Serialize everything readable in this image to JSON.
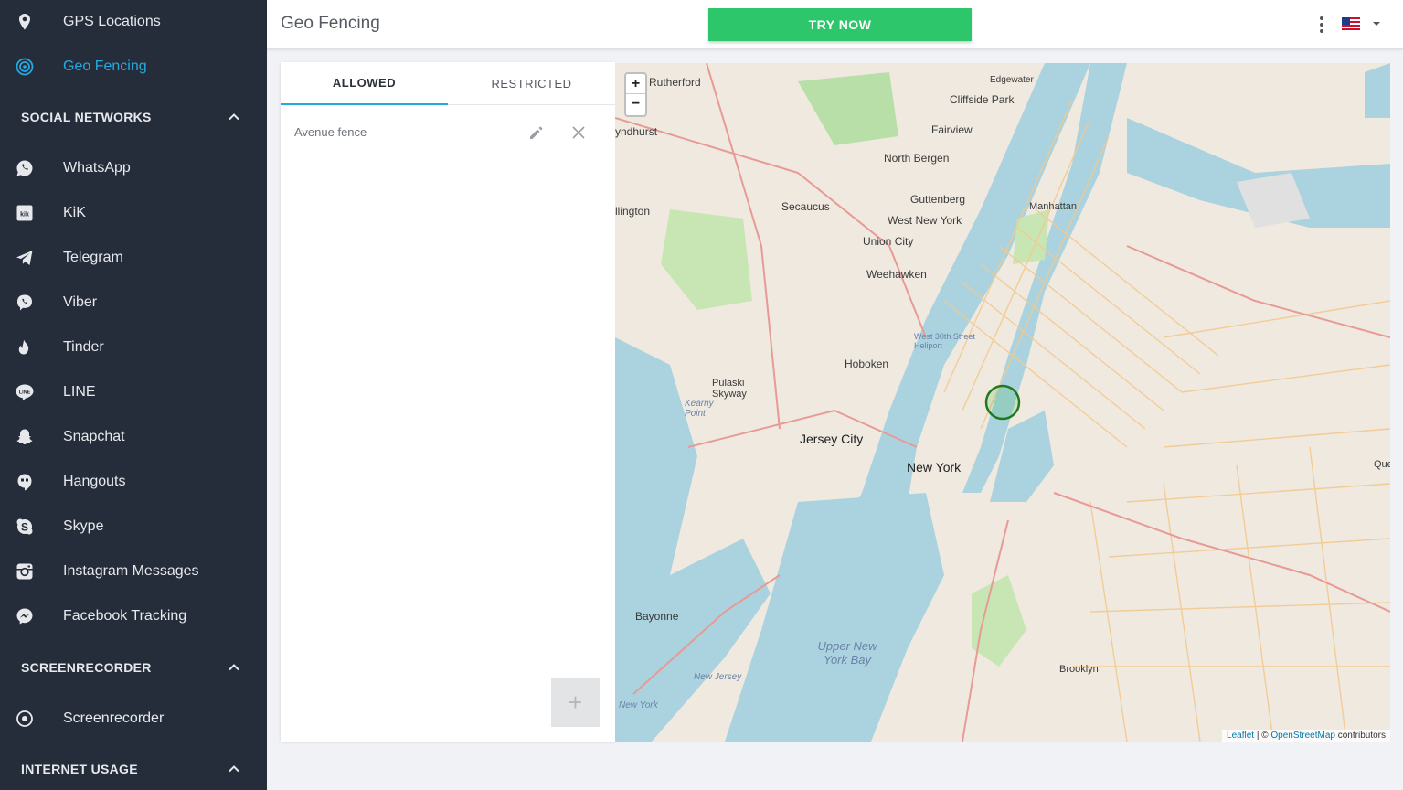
{
  "sidebar": {
    "top_items": [
      {
        "label": "GPS Locations",
        "icon": "map-pin-icon"
      },
      {
        "label": "Geo Fencing",
        "icon": "geofence-target-icon",
        "active": true
      }
    ],
    "social_networks": {
      "title": "SOCIAL NETWORKS",
      "items": [
        {
          "label": "WhatsApp",
          "icon": "whatsapp-icon"
        },
        {
          "label": "KiK",
          "icon": "kik-icon"
        },
        {
          "label": "Telegram",
          "icon": "telegram-icon"
        },
        {
          "label": "Viber",
          "icon": "viber-icon"
        },
        {
          "label": "Tinder",
          "icon": "tinder-icon"
        },
        {
          "label": "LINE",
          "icon": "line-icon"
        },
        {
          "label": "Snapchat",
          "icon": "snapchat-icon"
        },
        {
          "label": "Hangouts",
          "icon": "hangouts-icon"
        },
        {
          "label": "Skype",
          "icon": "skype-icon"
        },
        {
          "label": "Instagram Messages",
          "icon": "instagram-icon"
        },
        {
          "label": "Facebook Tracking",
          "icon": "messenger-icon"
        }
      ]
    },
    "screenrecorder": {
      "title": "SCREENRECORDER",
      "items": [
        {
          "label": "Screenrecorder",
          "icon": "record-icon"
        }
      ]
    },
    "internet_usage": {
      "title": "INTERNET USAGE"
    }
  },
  "header": {
    "title": "Geo Fencing",
    "try_now_label": "TRY NOW",
    "language_flag": "us-flag-icon"
  },
  "tabs": {
    "allowed_label": "ALLOWED",
    "restricted_label": "RESTRICTED",
    "active": "allowed"
  },
  "fences": [
    {
      "name": "Avenue fence"
    }
  ],
  "add_button_label": "+",
  "map": {
    "zoom_in": "+",
    "zoom_out": "−",
    "attribution_leaflet": "Leaflet",
    "attribution_sep": " | © ",
    "attribution_osm": "OpenStreetMap",
    "attribution_contrib": " contributors",
    "labels": [
      "Rutherford",
      "Edgewater",
      "Cliffside Park",
      "Fairview",
      "yndhurst",
      "North Bergen",
      "Guttenberg",
      "West New York",
      "Manhattan",
      "Secaucus",
      "llington",
      "Union City",
      "Weehawken",
      "West 30th Street Heliport",
      "Hoboken",
      "Pulaski Skyway",
      "Kearny Point",
      "Jersey City",
      "New York",
      "Bayonne",
      "Upper New York Bay",
      "Brooklyn",
      "New Jersey",
      "New York",
      "Que"
    ],
    "fence_circle_color": "#1e7a1e"
  },
  "colors": {
    "sidebar_bg": "#252d3a",
    "active": "#26a9e0",
    "try_now": "#2ec66b"
  }
}
